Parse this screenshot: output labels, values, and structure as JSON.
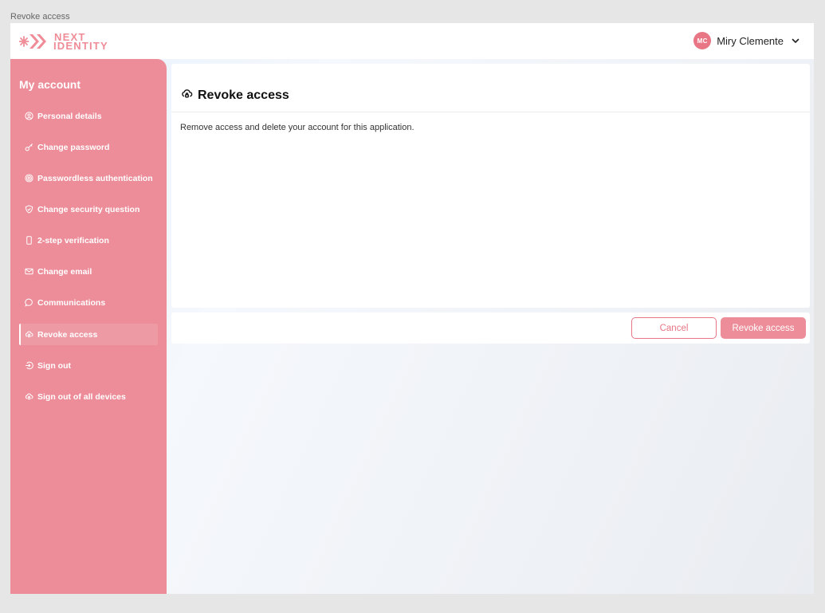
{
  "window": {
    "frame_label": "Revoke access"
  },
  "brand": {
    "logo_line1": "NEXT",
    "logo_line2": "IDENTITY",
    "color": "#ef8c97"
  },
  "user": {
    "initials": "MC",
    "name": "Miry Clemente",
    "avatar_color": "#e97685"
  },
  "sidebar": {
    "title": "My account",
    "background": "#ec8d99",
    "items": [
      {
        "label": "Personal details",
        "icon": "user-circle-icon",
        "active": false
      },
      {
        "label": "Change password",
        "icon": "key-icon",
        "active": false
      },
      {
        "label": "Passwordless authentication",
        "icon": "fingerprint-icon",
        "active": false
      },
      {
        "label": "Change security question",
        "icon": "shield-icon",
        "active": false
      },
      {
        "label": "2-step verification",
        "icon": "phone-icon",
        "active": false
      },
      {
        "label": "Change email",
        "icon": "mail-icon",
        "active": false
      },
      {
        "label": "Communications",
        "icon": "chat-bubble-icon",
        "active": false
      },
      {
        "label": "Revoke access",
        "icon": "cloud-lock-icon",
        "active": true
      },
      {
        "label": "Sign out",
        "icon": "sign-out-icon",
        "active": false
      },
      {
        "label": "Sign out of all devices",
        "icon": "cloud-lock-icon",
        "active": false
      }
    ]
  },
  "main": {
    "title": "Revoke access",
    "title_icon": "cloud-lock-icon",
    "description": "Remove access and delete your account for this application."
  },
  "actions": {
    "cancel_label": "Cancel",
    "revoke_label": "Revoke access"
  }
}
